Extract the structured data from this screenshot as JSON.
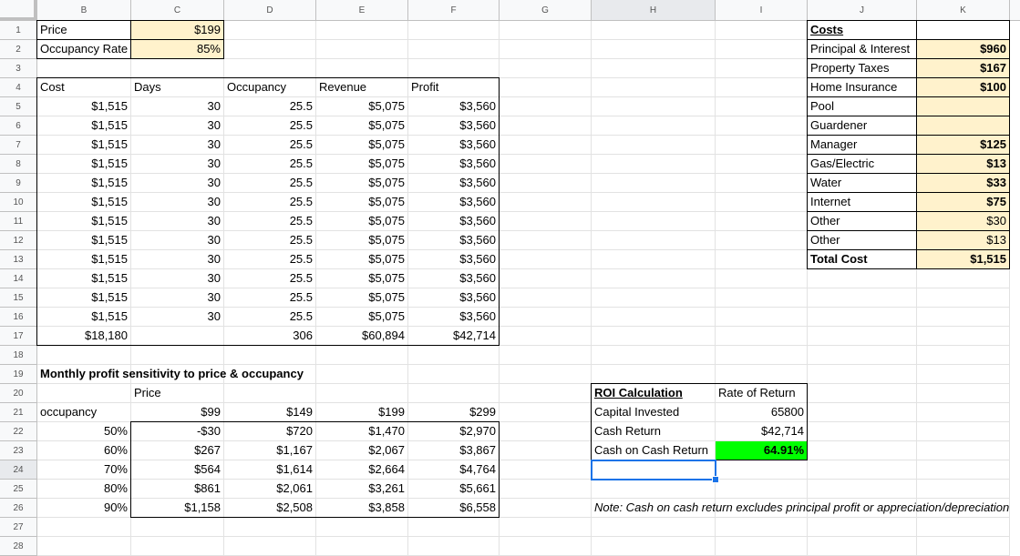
{
  "columns": [
    "B",
    "C",
    "D",
    "E",
    "F",
    "G",
    "H",
    "I",
    "J",
    "K"
  ],
  "active_column": "H",
  "active_row": 24,
  "rows": [
    1,
    2,
    3,
    4,
    5,
    6,
    7,
    8,
    9,
    10,
    11,
    12,
    13,
    14,
    15,
    16,
    17,
    18,
    19,
    20,
    21,
    22,
    23,
    24,
    25,
    26,
    27,
    28
  ],
  "inputs": {
    "price_label": "Price",
    "price_value": "$199",
    "occupancy_label": "Occupancy Rate",
    "occupancy_value": "85%"
  },
  "monthly_table": {
    "headers": [
      "Cost",
      "Days",
      "Occupancy",
      "Revenue",
      "Profit"
    ],
    "rows": [
      [
        "$1,515",
        "30",
        "25.5",
        "$5,075",
        "$3,560"
      ],
      [
        "$1,515",
        "30",
        "25.5",
        "$5,075",
        "$3,560"
      ],
      [
        "$1,515",
        "30",
        "25.5",
        "$5,075",
        "$3,560"
      ],
      [
        "$1,515",
        "30",
        "25.5",
        "$5,075",
        "$3,560"
      ],
      [
        "$1,515",
        "30",
        "25.5",
        "$5,075",
        "$3,560"
      ],
      [
        "$1,515",
        "30",
        "25.5",
        "$5,075",
        "$3,560"
      ],
      [
        "$1,515",
        "30",
        "25.5",
        "$5,075",
        "$3,560"
      ],
      [
        "$1,515",
        "30",
        "25.5",
        "$5,075",
        "$3,560"
      ],
      [
        "$1,515",
        "30",
        "25.5",
        "$5,075",
        "$3,560"
      ],
      [
        "$1,515",
        "30",
        "25.5",
        "$5,075",
        "$3,560"
      ],
      [
        "$1,515",
        "30",
        "25.5",
        "$5,075",
        "$3,560"
      ],
      [
        "$1,515",
        "30",
        "25.5",
        "$5,075",
        "$3,560"
      ]
    ],
    "totals": [
      "$18,180",
      "",
      "306",
      "$60,894",
      "$42,714"
    ]
  },
  "costs": {
    "title": "Costs",
    "items": [
      {
        "label": "Principal & Interest",
        "value": "$960",
        "bold": true
      },
      {
        "label": "Property Taxes",
        "value": "$167",
        "bold": true
      },
      {
        "label": "Home Insurance",
        "value": "$100",
        "bold": true
      },
      {
        "label": "Pool",
        "value": "",
        "bold": false
      },
      {
        "label": "Guardener",
        "value": "",
        "bold": false
      },
      {
        "label": "Manager",
        "value": "$125",
        "bold": true
      },
      {
        "label": "Gas/Electric",
        "value": "$13",
        "bold": true
      },
      {
        "label": "Water",
        "value": "$33",
        "bold": true
      },
      {
        "label": "Internet",
        "value": "$75",
        "bold": true
      },
      {
        "label": "Other",
        "value": "$30",
        "bold": false
      },
      {
        "label": "Other",
        "value": "$13",
        "bold": false
      }
    ],
    "total_label": "Total Cost",
    "total_value": "$1,515"
  },
  "sensitivity": {
    "title": "Monthly profit sensitivity to price & occupancy",
    "price_label": "Price",
    "occupancy_label": "occupancy",
    "prices": [
      "$99",
      "$149",
      "$199",
      "$299"
    ],
    "rows": [
      {
        "occ": "50%",
        "values": [
          "-$30",
          "$720",
          "$1,470",
          "$2,970"
        ]
      },
      {
        "occ": "60%",
        "values": [
          "$267",
          "$1,167",
          "$2,067",
          "$3,867"
        ]
      },
      {
        "occ": "70%",
        "values": [
          "$564",
          "$1,614",
          "$2,664",
          "$4,764"
        ]
      },
      {
        "occ": "80%",
        "values": [
          "$861",
          "$2,061",
          "$3,261",
          "$5,661"
        ]
      },
      {
        "occ": "90%",
        "values": [
          "$1,158",
          "$2,508",
          "$3,858",
          "$6,558"
        ]
      }
    ]
  },
  "roi": {
    "title": "ROI Calculation",
    "header": "Rate of Return",
    "capital_label": "Capital Invested",
    "capital_value": "65800",
    "cash_return_label": "Cash Return",
    "cash_return_value": "$42,714",
    "coc_label": "Cash on Cash Return",
    "coc_value": "64.91%",
    "coc_color": "#00ff00"
  },
  "note": "Note: Cash on cash return excludes principal profit or appreciation/depreciation"
}
